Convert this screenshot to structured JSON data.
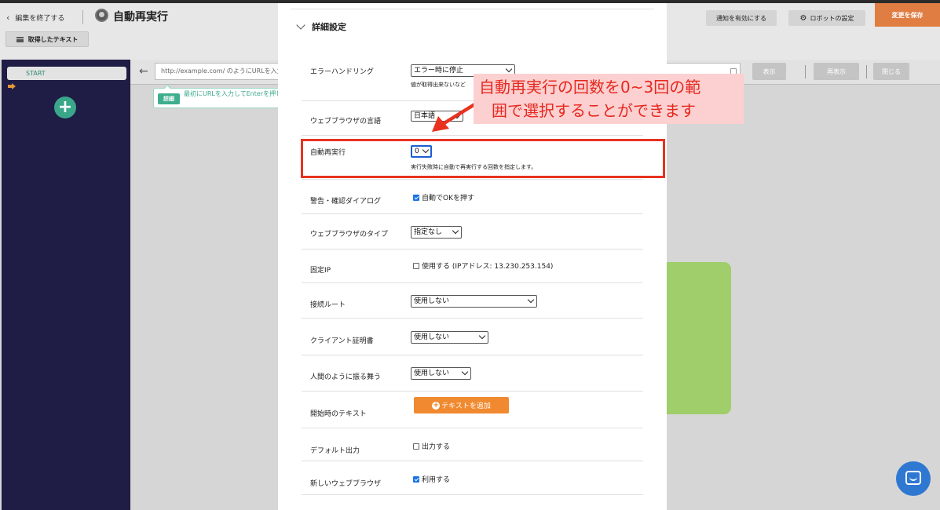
{
  "header": {
    "back_label": "編集を終了する",
    "robot_name": "自動再実行",
    "notify_label": "通知を有効にする",
    "robot_settings_label": "ロボットの設定",
    "save_label": "変更を保存",
    "extracted_text_label": "取得したテキスト"
  },
  "flow": {
    "start_label": "START",
    "add_symbol": "+"
  },
  "browser": {
    "url_placeholder": "http://example.com/ のようにURLを入力",
    "show_label": "表示",
    "reshow_label": "再表示",
    "close_label": "閉じる"
  },
  "tooltip": {
    "badge": "詳細",
    "text": "最初にURLを入力してEnterを押して下さい。"
  },
  "modal": {
    "section_title": "詳細設定",
    "rows": {
      "error_handling": {
        "label": "エラーハンドリング",
        "value": "エラー時に停止",
        "desc": "値が取得出来ないなど"
      },
      "browser_language": {
        "label": "ウェブブラウザの言語",
        "value": "日本語"
      },
      "auto_retry": {
        "label": "自動再実行",
        "value": "0",
        "desc": "実行失敗時に自動で再実行する回数を指定します。"
      },
      "alert_dialog": {
        "label": "警告・確認ダイアログ",
        "checkbox_label": "自動でOKを押す",
        "checked": true
      },
      "browser_type": {
        "label": "ウェブブラウザのタイプ",
        "value": "指定なし"
      },
      "fixed_ip": {
        "label": "固定IP",
        "checkbox_label": "使用する (IPアドレス: 13.230.253.154)",
        "checked": false
      },
      "connection_route": {
        "label": "接続ルート",
        "value": "使用しない"
      },
      "client_cert": {
        "label": "クライアント証明書",
        "value": "使用しない"
      },
      "human_like": {
        "label": "人間のように振る舞う",
        "value": "使用しない"
      },
      "start_text": {
        "label": "開始時のテキスト",
        "button_label": "テキストを追加"
      },
      "default_output": {
        "label": "デフォルト出力",
        "checkbox_label": "出力する",
        "checked": false
      },
      "new_browser": {
        "label": "新しいウェブブラウザ",
        "checkbox_label": "利用する",
        "checked": true
      }
    }
  },
  "annotation": {
    "callout_line1": "自動再実行の回数を0~3回の範",
    "callout_line2": "囲で選択することができます",
    "color": "#e8321f"
  },
  "colors": {
    "sidebar": "#1f1d45",
    "accent_green": "#3aa78a",
    "save_orange": "#e07d43",
    "add_button_orange": "#f0892f",
    "chat_blue": "#2f78d2"
  }
}
